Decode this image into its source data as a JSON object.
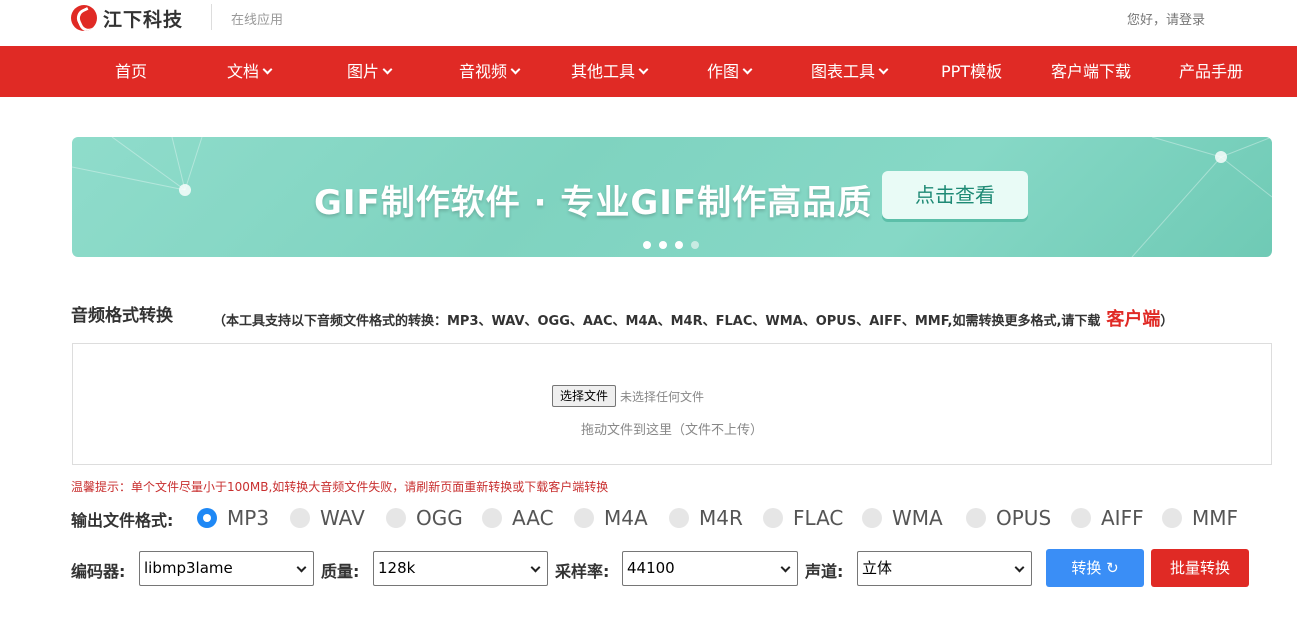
{
  "header": {
    "logo_text": "江下科技",
    "subtitle": "在线应用",
    "login": "您好，请登录"
  },
  "nav": {
    "items": [
      {
        "label": "首页",
        "dropdown": false
      },
      {
        "label": "文档",
        "dropdown": true
      },
      {
        "label": "图片",
        "dropdown": true
      },
      {
        "label": "音视频",
        "dropdown": true
      },
      {
        "label": "其他工具",
        "dropdown": true
      },
      {
        "label": "作图",
        "dropdown": true
      },
      {
        "label": "图表工具",
        "dropdown": true
      },
      {
        "label": "PPT模板",
        "dropdown": false
      },
      {
        "label": "客户端下载",
        "dropdown": false
      },
      {
        "label": "产品手册",
        "dropdown": false
      }
    ]
  },
  "banner": {
    "title": "GIF制作软件 · 专业GIF制作高品质",
    "button": "点击查看",
    "dots_total": 4,
    "dots_active": 3
  },
  "section": {
    "title": "音频格式转换",
    "desc": "（本工具支持以下音频文件格式的转换：MP3、WAV、OGG、AAC、M4A、M4R、FLAC、WMA、OPUS、AIFF、MMF,如需转换更多格式,请下载",
    "link": "客户端",
    "close_paren": "）"
  },
  "upload": {
    "choose_button": "选择文件",
    "no_file": "未选择任何文件",
    "drag_hint": "拖动文件到这里（文件不上传）"
  },
  "tip": "温馨提示：单个文件尽量小于100MB,如转换大音频文件失败，请刷新页面重新转换或下载客户端转换",
  "formats": {
    "label": "输出文件格式:",
    "selected": "MP3",
    "options": [
      "MP3",
      "WAV",
      "OGG",
      "AAC",
      "M4A",
      "M4R",
      "FLAC",
      "WMA",
      "OPUS",
      "AIFF",
      "MMF"
    ]
  },
  "options": {
    "encoder_label": "编码器:",
    "encoder_value": "libmp3lame",
    "quality_label": "质量:",
    "quality_value": "128k",
    "samplerate_label": "采样率:",
    "samplerate_value": "44100",
    "channel_label": "声道:",
    "channel_value": "立体"
  },
  "actions": {
    "convert": "转换",
    "batch": "批量转换"
  },
  "colors": {
    "brand_red": "#e02a25",
    "primary_blue": "#3a8ef6",
    "banner_teal": "#7fd3c0"
  }
}
